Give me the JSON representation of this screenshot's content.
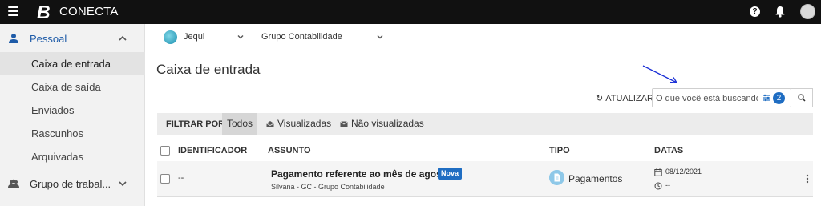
{
  "topbar": {
    "logo_letter": "B",
    "app_name": "CONECTA",
    "help_icon": "?"
  },
  "sidebar": {
    "group_pessoal": "Pessoal",
    "items": [
      {
        "label": "Caixa de entrada",
        "active": true
      },
      {
        "label": "Caixa de saída",
        "active": false
      },
      {
        "label": "Enviados",
        "active": false
      },
      {
        "label": "Rascunhos",
        "active": false
      },
      {
        "label": "Arquivadas",
        "active": false
      }
    ],
    "group_workgroup": "Grupo de trabal..."
  },
  "context": {
    "org_name": "Jequi",
    "group_name": "Grupo Contabilidade"
  },
  "page": {
    "title": "Caixa de entrada",
    "refresh_label": "ATUALIZAR",
    "search_placeholder": "O que você está buscando?",
    "filter_count": "2"
  },
  "filters": {
    "label": "FILTRAR POR",
    "options": [
      {
        "label": "Todos",
        "active": true
      },
      {
        "label": "Visualizadas",
        "icon": "envelope-open-icon"
      },
      {
        "label": "Não visualizadas",
        "icon": "envelope-icon"
      }
    ]
  },
  "table": {
    "headers": [
      "IDENTIFICADOR",
      "ASSUNTO",
      "TIPO",
      "DATAS"
    ],
    "rows": [
      {
        "id": "--",
        "subject": "Pagamento referente ao mês de agosto",
        "badge": "Nova",
        "sender": "Silvana - GC - Grupo Contabilidade",
        "type": "Pagamentos",
        "date": "08/12/2021",
        "date2": "--"
      }
    ]
  },
  "colors": {
    "topbar": "#111111",
    "accent": "#1f6dc2",
    "sidebar_active_text": "#1e5ba8",
    "arrow": "#1a2fd6"
  }
}
